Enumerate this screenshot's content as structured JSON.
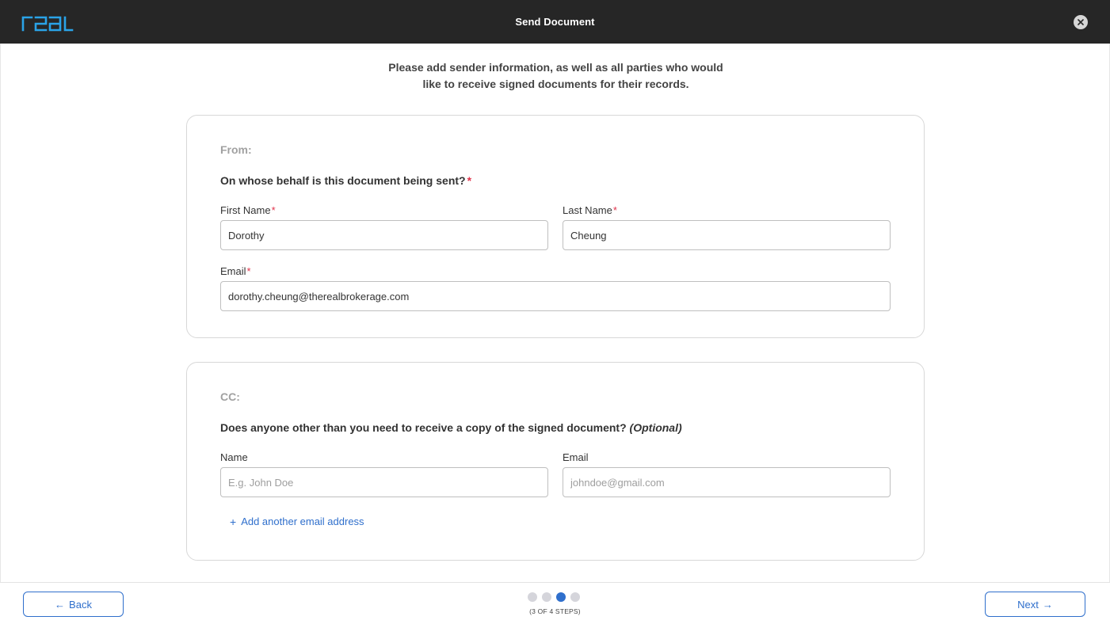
{
  "header": {
    "logo_text": "real",
    "title": "Send Document",
    "close_icon": "close-icon"
  },
  "intro": {
    "line1": "Please add sender information, as well as all parties who would",
    "line2": "like to receive signed documents for their records."
  },
  "from_section": {
    "label": "From:",
    "question": "On whose behalf is this document being sent?",
    "required_mark": "*",
    "first_name": {
      "label": "First Name",
      "value": "Dorothy"
    },
    "last_name": {
      "label": "Last Name",
      "value": "Cheung"
    },
    "email": {
      "label": "Email",
      "value": "dorothy.cheung@therealbrokerage.com"
    }
  },
  "cc_section": {
    "label": "CC:",
    "question": "Does anyone other than you need to receive a copy of the signed document?",
    "optional": "(Optional)",
    "name": {
      "label": "Name",
      "placeholder": "E.g. John Doe",
      "value": ""
    },
    "email": {
      "label": "Email",
      "placeholder": "johndoe@gmail.com",
      "value": ""
    },
    "add_link": "Add another email address"
  },
  "footer": {
    "back_label": "Back",
    "next_label": "Next",
    "back_arrow": "←",
    "next_arrow": "→",
    "current_step": 3,
    "total_steps": 4,
    "step_text": "(3 OF 4 STEPS)"
  },
  "colors": {
    "accent": "#2f6fcc",
    "header_bg": "#262626",
    "required": "#e0344c",
    "logo": "#2aa3e8"
  }
}
